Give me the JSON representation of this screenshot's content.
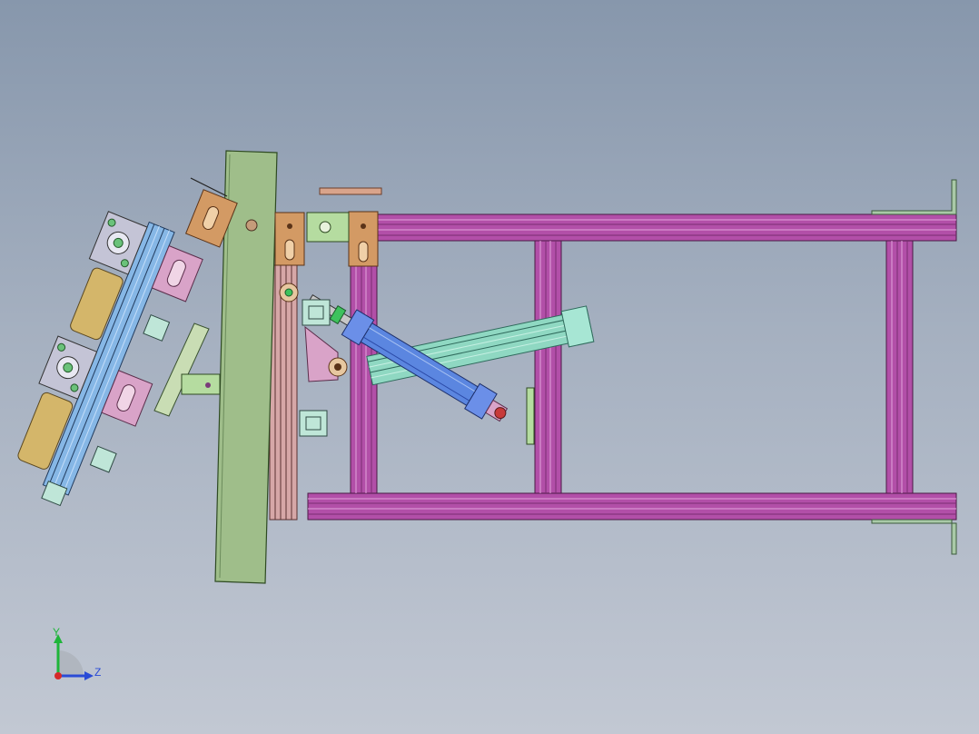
{
  "view": {
    "background_top": "#8797ac",
    "background_bottom": "#c2c8d3"
  },
  "triad": {
    "y_label": "Y",
    "z_label": "Z",
    "y_color": "#1fb53a",
    "z_color": "#2a4bd6",
    "x_color": "#d62a2a"
  },
  "colors": {
    "frame_rail": "#b24fa8",
    "frame_dark": "#7a2d72",
    "plate_green": "#9fbe8a",
    "bracket_orange": "#d39a64",
    "cylinder_blue": "#5b86e0",
    "profile_teal": "#8fd8c2",
    "clamp_pink": "#d9a3c8",
    "pad_tan": "#d4b66a",
    "extrusion_blue": "#86b7e6",
    "spacer_tan": "#d9a48b",
    "mount_grey": "#c4c4d6"
  }
}
